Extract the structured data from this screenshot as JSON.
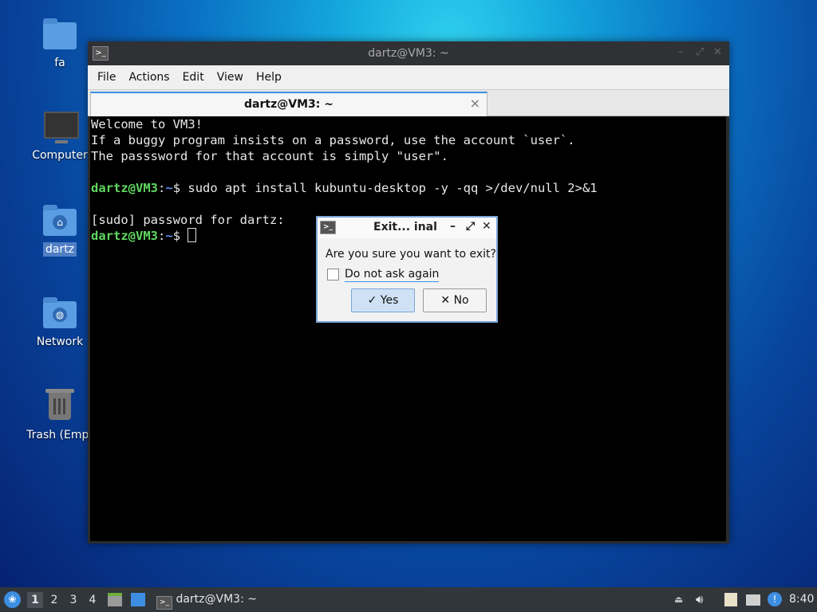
{
  "desktop": {
    "icons": [
      {
        "label": "fa"
      },
      {
        "label": "Computer"
      },
      {
        "label": "dartz"
      },
      {
        "label": "Network"
      },
      {
        "label": "Trash (Empt"
      }
    ]
  },
  "window": {
    "title": "dartz@VM3: ~",
    "menu": [
      "File",
      "Actions",
      "Edit",
      "View",
      "Help"
    ],
    "tab_label": "dartz@VM3: ~",
    "tab_close": "×"
  },
  "terminal": {
    "line1": "Welcome to VM3!",
    "line2": "If a buggy program insists on a password, use the account `user`.",
    "line3": "The passsword for that account is simply \"user\".",
    "prompt_user": "dartz@VM3",
    "prompt_colon": ":",
    "prompt_path": "~",
    "prompt_dollar": "$ ",
    "command": "sudo apt install kubuntu-desktop -y -qq >/dev/null 2>&1",
    "sudo_line": "[sudo] password for dartz: "
  },
  "dialog": {
    "title": "Exit...  inal",
    "question": "Are you sure you want to exit?",
    "checkbox_label": "Do not ask again",
    "checkbox_checked": false,
    "yes_label": "Yes",
    "no_label": "No"
  },
  "taskbar": {
    "workspaces": [
      "1",
      "2",
      "3",
      "4"
    ],
    "active_workspace": "1",
    "task_label": "dartz@VM3: ~",
    "clock": "8:40"
  }
}
